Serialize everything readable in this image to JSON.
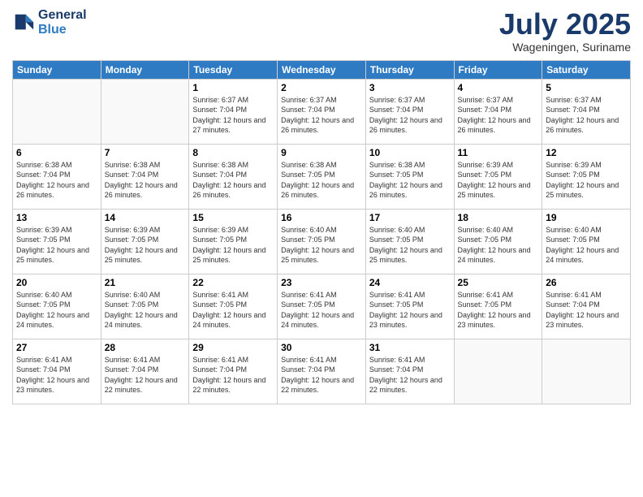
{
  "logo": {
    "line1": "General",
    "line2": "Blue"
  },
  "title": "July 2025",
  "subtitle": "Wageningen, Suriname",
  "days_of_week": [
    "Sunday",
    "Monday",
    "Tuesday",
    "Wednesday",
    "Thursday",
    "Friday",
    "Saturday"
  ],
  "weeks": [
    [
      {
        "day": "",
        "info": ""
      },
      {
        "day": "",
        "info": ""
      },
      {
        "day": "1",
        "sunrise": "Sunrise: 6:37 AM",
        "sunset": "Sunset: 7:04 PM",
        "daylight": "Daylight: 12 hours and 27 minutes."
      },
      {
        "day": "2",
        "sunrise": "Sunrise: 6:37 AM",
        "sunset": "Sunset: 7:04 PM",
        "daylight": "Daylight: 12 hours and 26 minutes."
      },
      {
        "day": "3",
        "sunrise": "Sunrise: 6:37 AM",
        "sunset": "Sunset: 7:04 PM",
        "daylight": "Daylight: 12 hours and 26 minutes."
      },
      {
        "day": "4",
        "sunrise": "Sunrise: 6:37 AM",
        "sunset": "Sunset: 7:04 PM",
        "daylight": "Daylight: 12 hours and 26 minutes."
      },
      {
        "day": "5",
        "sunrise": "Sunrise: 6:37 AM",
        "sunset": "Sunset: 7:04 PM",
        "daylight": "Daylight: 12 hours and 26 minutes."
      }
    ],
    [
      {
        "day": "6",
        "sunrise": "Sunrise: 6:38 AM",
        "sunset": "Sunset: 7:04 PM",
        "daylight": "Daylight: 12 hours and 26 minutes."
      },
      {
        "day": "7",
        "sunrise": "Sunrise: 6:38 AM",
        "sunset": "Sunset: 7:04 PM",
        "daylight": "Daylight: 12 hours and 26 minutes."
      },
      {
        "day": "8",
        "sunrise": "Sunrise: 6:38 AM",
        "sunset": "Sunset: 7:04 PM",
        "daylight": "Daylight: 12 hours and 26 minutes."
      },
      {
        "day": "9",
        "sunrise": "Sunrise: 6:38 AM",
        "sunset": "Sunset: 7:05 PM",
        "daylight": "Daylight: 12 hours and 26 minutes."
      },
      {
        "day": "10",
        "sunrise": "Sunrise: 6:38 AM",
        "sunset": "Sunset: 7:05 PM",
        "daylight": "Daylight: 12 hours and 26 minutes."
      },
      {
        "day": "11",
        "sunrise": "Sunrise: 6:39 AM",
        "sunset": "Sunset: 7:05 PM",
        "daylight": "Daylight: 12 hours and 25 minutes."
      },
      {
        "day": "12",
        "sunrise": "Sunrise: 6:39 AM",
        "sunset": "Sunset: 7:05 PM",
        "daylight": "Daylight: 12 hours and 25 minutes."
      }
    ],
    [
      {
        "day": "13",
        "sunrise": "Sunrise: 6:39 AM",
        "sunset": "Sunset: 7:05 PM",
        "daylight": "Daylight: 12 hours and 25 minutes."
      },
      {
        "day": "14",
        "sunrise": "Sunrise: 6:39 AM",
        "sunset": "Sunset: 7:05 PM",
        "daylight": "Daylight: 12 hours and 25 minutes."
      },
      {
        "day": "15",
        "sunrise": "Sunrise: 6:39 AM",
        "sunset": "Sunset: 7:05 PM",
        "daylight": "Daylight: 12 hours and 25 minutes."
      },
      {
        "day": "16",
        "sunrise": "Sunrise: 6:40 AM",
        "sunset": "Sunset: 7:05 PM",
        "daylight": "Daylight: 12 hours and 25 minutes."
      },
      {
        "day": "17",
        "sunrise": "Sunrise: 6:40 AM",
        "sunset": "Sunset: 7:05 PM",
        "daylight": "Daylight: 12 hours and 25 minutes."
      },
      {
        "day": "18",
        "sunrise": "Sunrise: 6:40 AM",
        "sunset": "Sunset: 7:05 PM",
        "daylight": "Daylight: 12 hours and 24 minutes."
      },
      {
        "day": "19",
        "sunrise": "Sunrise: 6:40 AM",
        "sunset": "Sunset: 7:05 PM",
        "daylight": "Daylight: 12 hours and 24 minutes."
      }
    ],
    [
      {
        "day": "20",
        "sunrise": "Sunrise: 6:40 AM",
        "sunset": "Sunset: 7:05 PM",
        "daylight": "Daylight: 12 hours and 24 minutes."
      },
      {
        "day": "21",
        "sunrise": "Sunrise: 6:40 AM",
        "sunset": "Sunset: 7:05 PM",
        "daylight": "Daylight: 12 hours and 24 minutes."
      },
      {
        "day": "22",
        "sunrise": "Sunrise: 6:41 AM",
        "sunset": "Sunset: 7:05 PM",
        "daylight": "Daylight: 12 hours and 24 minutes."
      },
      {
        "day": "23",
        "sunrise": "Sunrise: 6:41 AM",
        "sunset": "Sunset: 7:05 PM",
        "daylight": "Daylight: 12 hours and 24 minutes."
      },
      {
        "day": "24",
        "sunrise": "Sunrise: 6:41 AM",
        "sunset": "Sunset: 7:05 PM",
        "daylight": "Daylight: 12 hours and 23 minutes."
      },
      {
        "day": "25",
        "sunrise": "Sunrise: 6:41 AM",
        "sunset": "Sunset: 7:05 PM",
        "daylight": "Daylight: 12 hours and 23 minutes."
      },
      {
        "day": "26",
        "sunrise": "Sunrise: 6:41 AM",
        "sunset": "Sunset: 7:04 PM",
        "daylight": "Daylight: 12 hours and 23 minutes."
      }
    ],
    [
      {
        "day": "27",
        "sunrise": "Sunrise: 6:41 AM",
        "sunset": "Sunset: 7:04 PM",
        "daylight": "Daylight: 12 hours and 23 minutes."
      },
      {
        "day": "28",
        "sunrise": "Sunrise: 6:41 AM",
        "sunset": "Sunset: 7:04 PM",
        "daylight": "Daylight: 12 hours and 22 minutes."
      },
      {
        "day": "29",
        "sunrise": "Sunrise: 6:41 AM",
        "sunset": "Sunset: 7:04 PM",
        "daylight": "Daylight: 12 hours and 22 minutes."
      },
      {
        "day": "30",
        "sunrise": "Sunrise: 6:41 AM",
        "sunset": "Sunset: 7:04 PM",
        "daylight": "Daylight: 12 hours and 22 minutes."
      },
      {
        "day": "31",
        "sunrise": "Sunrise: 6:41 AM",
        "sunset": "Sunset: 7:04 PM",
        "daylight": "Daylight: 12 hours and 22 minutes."
      },
      {
        "day": "",
        "info": ""
      },
      {
        "day": "",
        "info": ""
      }
    ]
  ]
}
